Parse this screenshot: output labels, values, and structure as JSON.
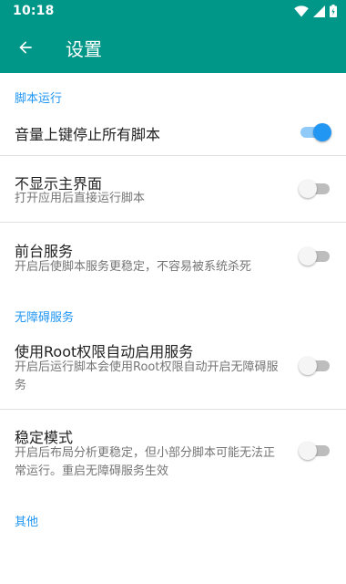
{
  "status_bar": {
    "time": "10:18"
  },
  "toolbar": {
    "title": "设置"
  },
  "sections": {
    "script_run": {
      "title": "脚本运行",
      "stop_scripts_volume": {
        "title": "音量上键停止所有脚本",
        "enabled": true
      },
      "hide_main_ui": {
        "title": "不显示主界面",
        "summary": "打开应用后直接运行脚本",
        "enabled": false
      },
      "foreground_service": {
        "title": "前台服务",
        "summary": "开启后使脚本服务更稳定，不容易被系统杀死",
        "enabled": false
      }
    },
    "accessibility": {
      "title": "无障碍服务",
      "root_auto_enable": {
        "title": "使用Root权限自动启用服务",
        "summary": "开启后运行脚本会使用Root权限自动开启无障碍服务",
        "enabled": false
      },
      "stable_mode": {
        "title": "稳定模式",
        "summary": "开启后布局分析更稳定，但小部分脚本可能无法正常运行。重启无障碍服务生效",
        "enabled": false
      }
    },
    "other": {
      "title": "其他"
    }
  },
  "colors": {
    "appbar": "#009688",
    "accent": "#2196f3",
    "category_text": "#2196f3"
  },
  "icons": {
    "back": "arrow-back-icon",
    "wifi": "wifi-icon",
    "signal": "signal-icon",
    "battery": "battery-icon"
  }
}
